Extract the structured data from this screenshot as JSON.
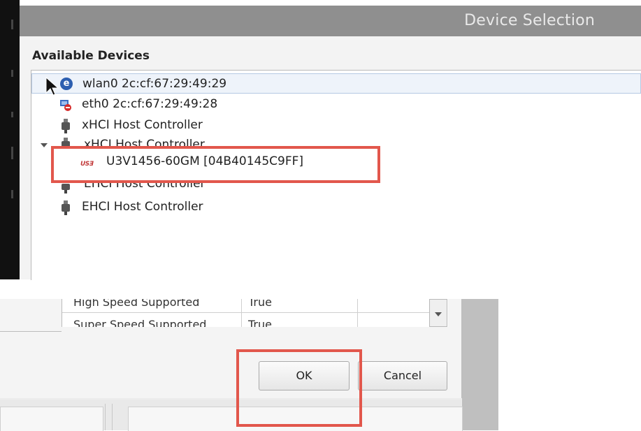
{
  "dialog": {
    "title": "Device Selection",
    "section_label": "Available Devices"
  },
  "devices": [
    {
      "label": "wlan0 2c:cf:67:29:49:29",
      "icon": "network-globe-icon",
      "selected": true
    },
    {
      "label": "eth0 2c:cf:67:29:49:28",
      "icon": "ethernet-disconnected-icon",
      "selected": false
    },
    {
      "label": "xHCI Host Controller",
      "icon": "usb-plug-icon",
      "selected": false
    },
    {
      "label": "xHCI Host Controller",
      "icon": "usb-plug-icon",
      "expanded": true,
      "partially_obscured": true
    },
    {
      "label": "U3V1456-60GM [04B40145C9FF]",
      "icon": "u3v-camera-icon",
      "highlighted": true
    },
    {
      "label": "EHCI Host Controller",
      "icon": "usb-plug-icon",
      "partially_obscured": true
    },
    {
      "label": "EHCI Host Controller",
      "icon": "usb-plug-icon",
      "selected": false
    }
  ],
  "properties": {
    "rows": [
      {
        "name": "High Speed Supported",
        "value": "True"
      },
      {
        "name": "Super Speed Supported",
        "value": "True"
      }
    ]
  },
  "buttons": {
    "ok_label": "OK",
    "cancel_label": "Cancel"
  },
  "colors": {
    "highlight": "#e2574c",
    "titlebar": "#8f8f8f",
    "selection": "#eef3fa"
  }
}
